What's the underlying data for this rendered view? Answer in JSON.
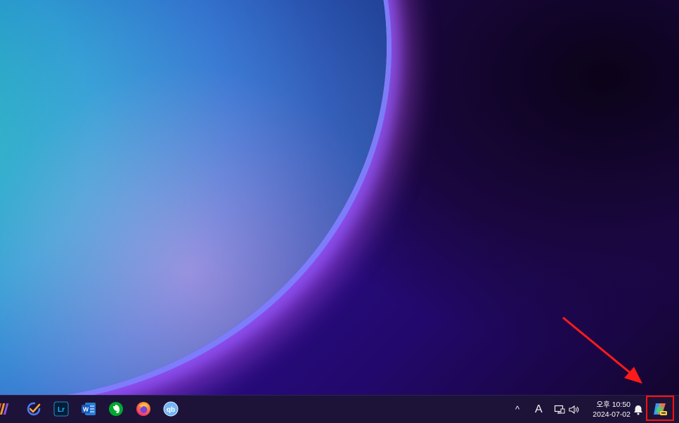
{
  "taskbar": {
    "pinned_apps": [
      {
        "name": "app-stripes-icon"
      },
      {
        "name": "todo-check-icon"
      },
      {
        "name": "lightroom-icon",
        "label": "Lr"
      },
      {
        "name": "word-icon",
        "label": "W"
      },
      {
        "name": "evernote-icon"
      },
      {
        "name": "firefox-icon"
      },
      {
        "name": "qbittorrent-icon",
        "label": "qb"
      }
    ],
    "tray": {
      "chevron": "^",
      "ime_label": "A",
      "clock": {
        "time": "오후 10:50",
        "date": "2024-07-02"
      }
    },
    "colors": {
      "highlight_box": "#ff1010",
      "arrow": "#ff1a1a"
    }
  }
}
